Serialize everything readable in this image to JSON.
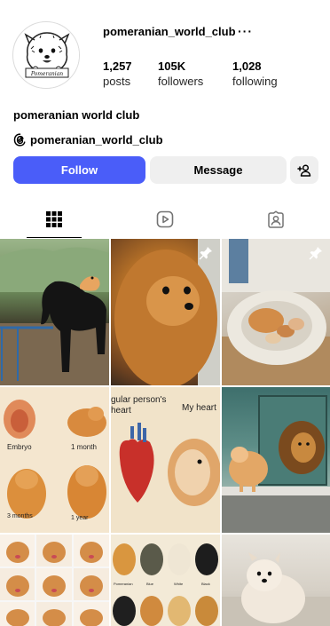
{
  "profile": {
    "username": "pomeranian_world_club",
    "more_label": "···",
    "avatar_text": "Pomeranian",
    "full_name": "pomeranian world club",
    "threads_handle": "pomeranian_world_club"
  },
  "stats": {
    "posts_value": "1,257",
    "posts_label": "posts",
    "followers_value": "105K",
    "followers_label": "followers",
    "following_value": "1,028",
    "following_label": "following"
  },
  "actions": {
    "follow_label": "Follow",
    "message_label": "Message",
    "add_person_icon": "add-person-icon"
  },
  "tabs": [
    {
      "icon": "grid-icon",
      "active": true
    },
    {
      "icon": "reels-icon",
      "active": false
    },
    {
      "icon": "tagged-icon",
      "active": false
    }
  ],
  "posts": {
    "embryo_label": "Embryo",
    "one_month_label": "1 month",
    "three_months_label": "3 months",
    "one_year_label": "1 year",
    "regular_heart_label": "gular person's\nheart",
    "my_heart_label": "My heart",
    "color_labels": [
      "Pomeranian",
      "Blue",
      "White",
      "Black"
    ]
  },
  "colors": {
    "follow_button": "#4a5df9",
    "secondary_button": "#efefef",
    "text": "#000000"
  }
}
